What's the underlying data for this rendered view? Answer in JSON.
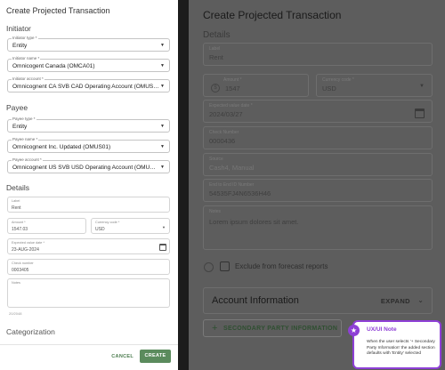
{
  "left": {
    "title": "Create Projected Transaction",
    "initiator": {
      "heading": "Initiator",
      "type_label": "Initiator type *",
      "type_value": "Entity",
      "name_label": "Initiator name *",
      "name_value": "Omnicogent Canada (OMCA01)",
      "account_label": "Initiator account *",
      "account_value": "Omnicognent CA SVB CAD Operating Account (OMUS01)"
    },
    "payee": {
      "heading": "Payee",
      "type_label": "Payee type *",
      "type_value": "Entity",
      "name_label": "Payee name *",
      "name_value": "Omnicognent Inc. Updated (OMUS01)",
      "account_label": "Payee account *",
      "account_value": "Omnicognent US SVB USD Operating Account (OMUS01)"
    },
    "details": {
      "heading": "Details",
      "label_label": "Label",
      "label_value": "Rent",
      "amount_label": "Amount *",
      "amount_value": "1547.03",
      "currency_label": "Currency code *",
      "currency_value": "USD",
      "date_label": "Expected value date *",
      "date_value": "23-AUG-2024",
      "check_label": "Check number",
      "check_value": "0003405",
      "notes_label": "Notes",
      "char_count": "20/2048"
    },
    "categorization_heading": "Categorization",
    "cancel_label": "CANCEL",
    "create_label": "CREATE"
  },
  "right": {
    "title": "Create Projected Transaction",
    "details_heading": "Details",
    "label_label": "Label",
    "label_value": "Rent",
    "amount_label": "Amount *",
    "amount_value": "1547",
    "currency_symbol": "$",
    "currency_label": "Currency code *",
    "currency_value": "USD",
    "date_label": "Expected value date *",
    "date_value": "2024/03/27",
    "check_label": "Check Number",
    "check_value": "0000436",
    "source_label": "Source",
    "source_value": "Cash4, Manual",
    "e2e_label": "End to End ID Number",
    "e2e_value": "54535FJ4N6536H46",
    "notes_label": "Notes",
    "notes_value": "Lorem ipsum dolores sit amet.",
    "exclude_label": "Exclude from forecast reports",
    "account_info_title": "Account Information",
    "expand_label": "EXPAND",
    "secondary_label": "SECONDARY PARTY INFORMATION"
  },
  "note": {
    "title": "UX/UI Note",
    "body": "When the user selects '+ Secondary Party Information' the added section defaults with 'Entity' selected"
  },
  "colors": {
    "accent_green": "#5b8b5d",
    "note_purple": "#8e3fd6",
    "overlay_gray": "#5d5d5d",
    "background_dark": "#1c1c1c"
  },
  "icons": [
    "chevron-down-icon",
    "calendar-icon",
    "currency-icon",
    "info-icon",
    "plus-icon",
    "star-icon"
  ]
}
